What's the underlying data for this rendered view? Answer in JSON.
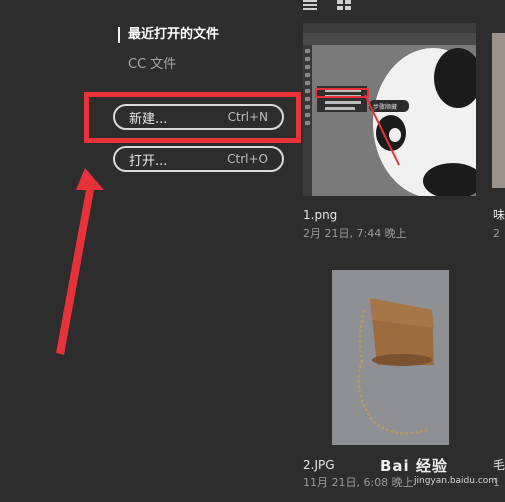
{
  "nav": {
    "recent": "最近打开的文件",
    "cc_files": "CC 文件"
  },
  "buttons": {
    "new_label": "新建...",
    "new_shortcut": "Ctrl+N",
    "open_label": "打开...",
    "open_shortcut": "Ctrl+O"
  },
  "files": [
    {
      "name": "1.png",
      "date": "2月 21日, 7:44 晚上"
    },
    {
      "name": "2.JPG",
      "date": "11月 21日, 6:08 晚上"
    }
  ],
  "partial_right": {
    "name_top": "味",
    "date_top": "2",
    "name_bottom": "毛",
    "date_bottom": "1"
  },
  "thumb1_popup": "步骤顺藏",
  "watermark": {
    "brand": "Bai 经验",
    "url": "jingyan.baidu.com"
  },
  "colors": {
    "accent_red": "#e8323a",
    "background": "#2d2d2d"
  }
}
